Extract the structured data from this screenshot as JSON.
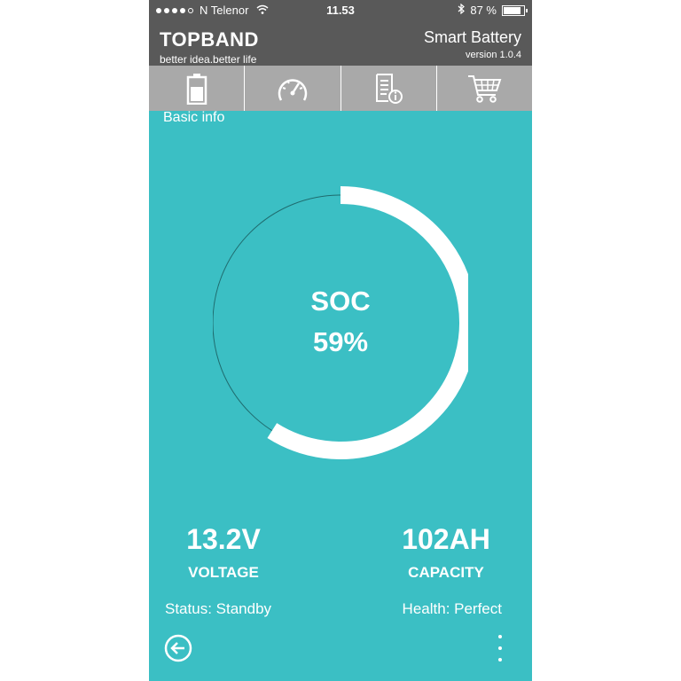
{
  "status_bar": {
    "carrier": "N Telenor",
    "time": "11.53",
    "battery_percent": "87 %",
    "battery_fill": 0.87,
    "signal_dots_filled": 4,
    "signal_dots_total": 5
  },
  "header": {
    "brand": "TOPBAND",
    "slogan": "better idea.better life",
    "app_title": "Smart Battery",
    "version": "version 1.0.4"
  },
  "tabs": [
    {
      "icon": "battery-icon",
      "active": true
    },
    {
      "icon": "speedometer-icon",
      "active": false
    },
    {
      "icon": "document-info-icon",
      "active": false
    },
    {
      "icon": "shopping-cart-icon",
      "active": false
    }
  ],
  "section_label": "Basic info",
  "soc": {
    "label": "SOC",
    "value_text": "59%",
    "fraction": 0.59
  },
  "voltage": {
    "value": "13.2V",
    "label": "VOLTAGE"
  },
  "capacity": {
    "value": "102AH",
    "label": "CAPACITY"
  },
  "status": "Status: Standby",
  "health": "Health: Perfect",
  "colors": {
    "background": "#3bbfc4",
    "header": "#595959",
    "tabbar": "#a9a9a9",
    "foreground": "#ffffff"
  }
}
